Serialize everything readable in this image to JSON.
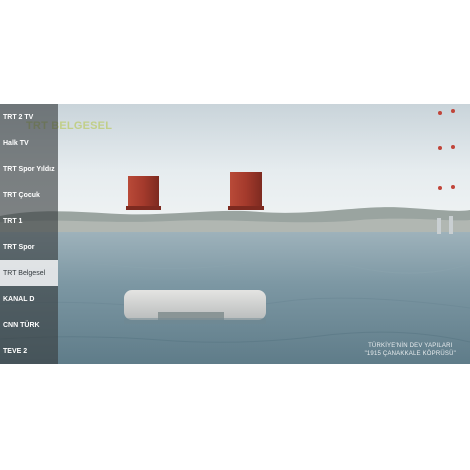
{
  "channels": [
    {
      "label": "TRT 2 TV"
    },
    {
      "label": "Halk TV"
    },
    {
      "label": "TRT Spor Yıldız"
    },
    {
      "label": "TRT Çocuk"
    },
    {
      "label": "TRT 1"
    },
    {
      "label": "TRT Spor"
    },
    {
      "label": "TRT Belgesel",
      "selected": true
    },
    {
      "label": "KANAL D"
    },
    {
      "label": "CNN TÜRK"
    },
    {
      "label": "TEVE 2"
    }
  ],
  "video": {
    "watermark": "TRT BELGESEL",
    "caption_line1": "TÜRKİYE'NİN DEV YAPILARI",
    "caption_line2": "\"1915 ÇANAKKALE KÖPRÜSÜ\""
  },
  "colors": {
    "sky": "#e3eaee",
    "sea": "#6f8d9a",
    "tower": "#a4382b",
    "list_bg": "#3a3f41",
    "selected_bg": "#eceef0"
  }
}
